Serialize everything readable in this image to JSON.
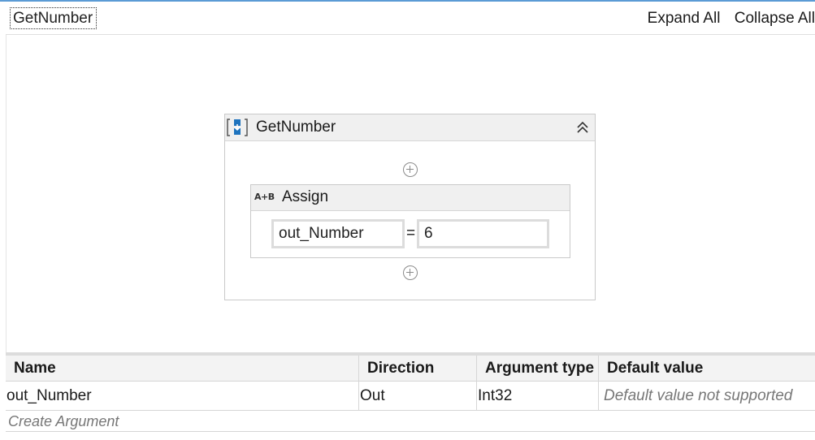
{
  "breadcrumb": "GetNumber",
  "toolbar": {
    "expand_all": "Expand All",
    "collapse_all": "Collapse All"
  },
  "sequence": {
    "title": "GetNumber",
    "icon": "sequence-icon",
    "collapse_icon": "double-chevron-up-icon",
    "assign": {
      "title": "Assign",
      "icon_text": "A+B",
      "to": "out_Number",
      "operator": "=",
      "value": "6"
    }
  },
  "arguments": {
    "columns": [
      "Name",
      "Direction",
      "Argument type",
      "Default value"
    ],
    "rows": [
      {
        "name": "out_Number",
        "direction": "Out",
        "type": "Int32",
        "default": "Default value not supported"
      }
    ],
    "create": "Create Argument"
  },
  "colors": {
    "accent": "#5b9bd5",
    "header_bg": "#f0f0f0",
    "border": "#c9c9c9",
    "sequence_icon": "#1e73be"
  }
}
